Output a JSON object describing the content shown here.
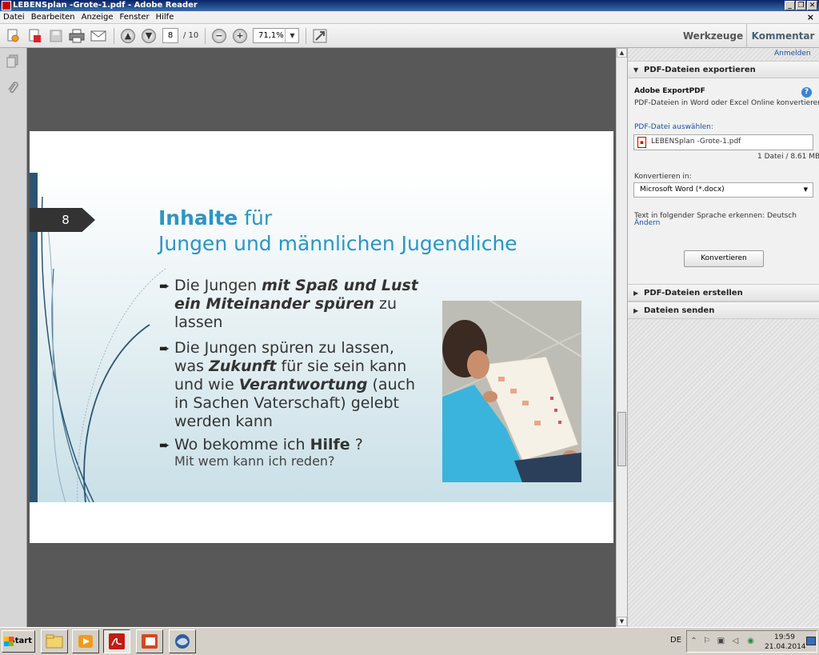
{
  "window": {
    "title": "LEBENSplan -Grote-1.pdf - Adobe Reader",
    "controls": [
      "_",
      "❐",
      "✕"
    ]
  },
  "menu": {
    "items": [
      "Datei",
      "Bearbeiten",
      "Anzeige",
      "Fenster",
      "Hilfe"
    ],
    "close": "×"
  },
  "toolbar": {
    "page_current": "8",
    "page_total": "/ 10",
    "zoom": "71,1%",
    "tools_label": "Werkzeuge",
    "comment_label": "Kommentar"
  },
  "slide": {
    "number": "8",
    "title_bold": "Inhalte",
    "title_rest": " für",
    "title_line2": "Jungen und männlichen Jugendliche",
    "bullets": [
      {
        "parts": [
          "Die Jungen ",
          "mit Spaß und Lust ein Miteinander spüren",
          " zu lassen"
        ]
      },
      {
        "parts": [
          "Die Jungen spüren zu lassen, was ",
          "Zukunft",
          " für sie sein kann und wie ",
          "Verantwortung",
          " (auch in Sachen Vaterschaft) gelebt werden kann"
        ]
      },
      {
        "parts": [
          "Wo bekomme ich ",
          "Hilfe",
          " ?"
        ]
      }
    ],
    "sub_line": "Mit wem kann ich reden?"
  },
  "panel": {
    "login": "Anmelden",
    "export_header": "PDF-Dateien exportieren",
    "export_title": "Adobe ExportPDF",
    "export_desc": "PDF-Dateien in Word oder Excel Online konvertieren.",
    "select_label": "PDF-Datei auswählen:",
    "file_name": "LEBENSplan -Grote-1.pdf",
    "file_count": "1 Datei / 8.61 MB",
    "convert_label": "Konvertieren in:",
    "convert_option": "Microsoft Word (*.docx)",
    "language_text": "Text in folgender Sprache erkennen: Deutsch",
    "language_change": "Ändern",
    "convert_button": "Konvertieren",
    "create_header": "PDF-Dateien erstellen",
    "send_header": "Dateien senden"
  },
  "taskbar": {
    "start": "Start",
    "lang": "DE",
    "time": "19:59",
    "date": "21.04.2014"
  },
  "icons": {
    "app": "pdf-icon",
    "nav": [
      "pages-icon",
      "paperclip-icon"
    ],
    "toolbar": [
      "create-pdf-icon",
      "export-pdf-icon",
      "save-icon",
      "print-icon",
      "email-icon",
      "page-up-icon",
      "page-down-icon",
      "zoom-out-icon",
      "zoom-in-icon",
      "fullscreen-icon"
    ]
  }
}
